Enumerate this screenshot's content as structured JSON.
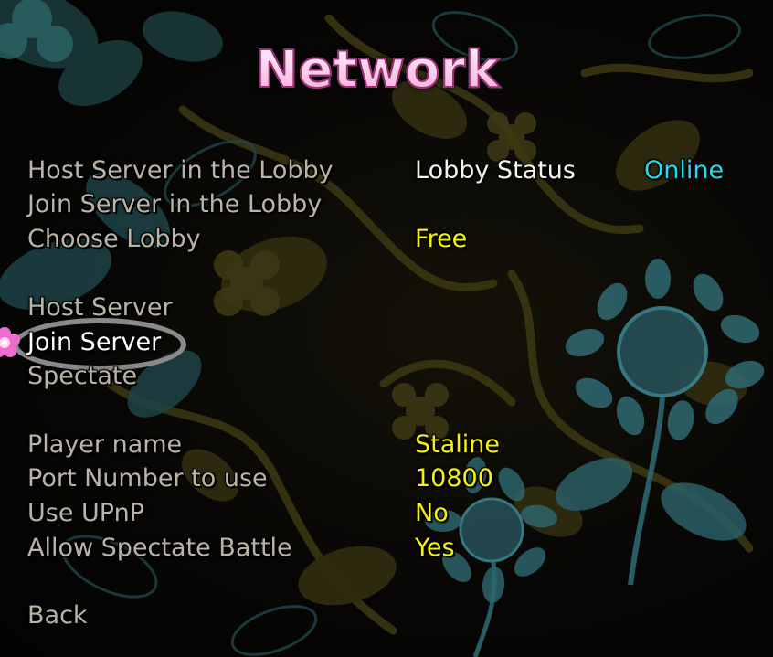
{
  "title": "Network",
  "lobby_menu": {
    "host_server_in_lobby": "Host Server in the Lobby",
    "join_server_in_lobby": "Join Server in the Lobby",
    "choose_lobby": "Choose Lobby"
  },
  "lobby_info": {
    "status_label": "Lobby Status",
    "status_value": "Online",
    "lobby_value": "Free"
  },
  "server_menu": {
    "host_server": "Host Server",
    "join_server": "Join Server",
    "spectate": "Spectate",
    "selected": "Join Server"
  },
  "settings": {
    "player_name_label": "Player name",
    "player_name_value": "Staline",
    "port_label": "Port Number to use",
    "port_value": "10800",
    "upnp_label": "Use UPnP",
    "upnp_value": "No",
    "spectate_battle_label": "Allow Spectate Battle",
    "spectate_battle_value": "Yes"
  },
  "back": "Back",
  "colors": {
    "title_pink": "#f6a9d8",
    "value_yellow": "#f4f20a",
    "status_cyan": "#18e0f0",
    "item_grey": "#b9b4a6",
    "selection_ring": "#8a8a8a"
  },
  "icons": {
    "cursor": "pink-flower-cursor-icon"
  }
}
